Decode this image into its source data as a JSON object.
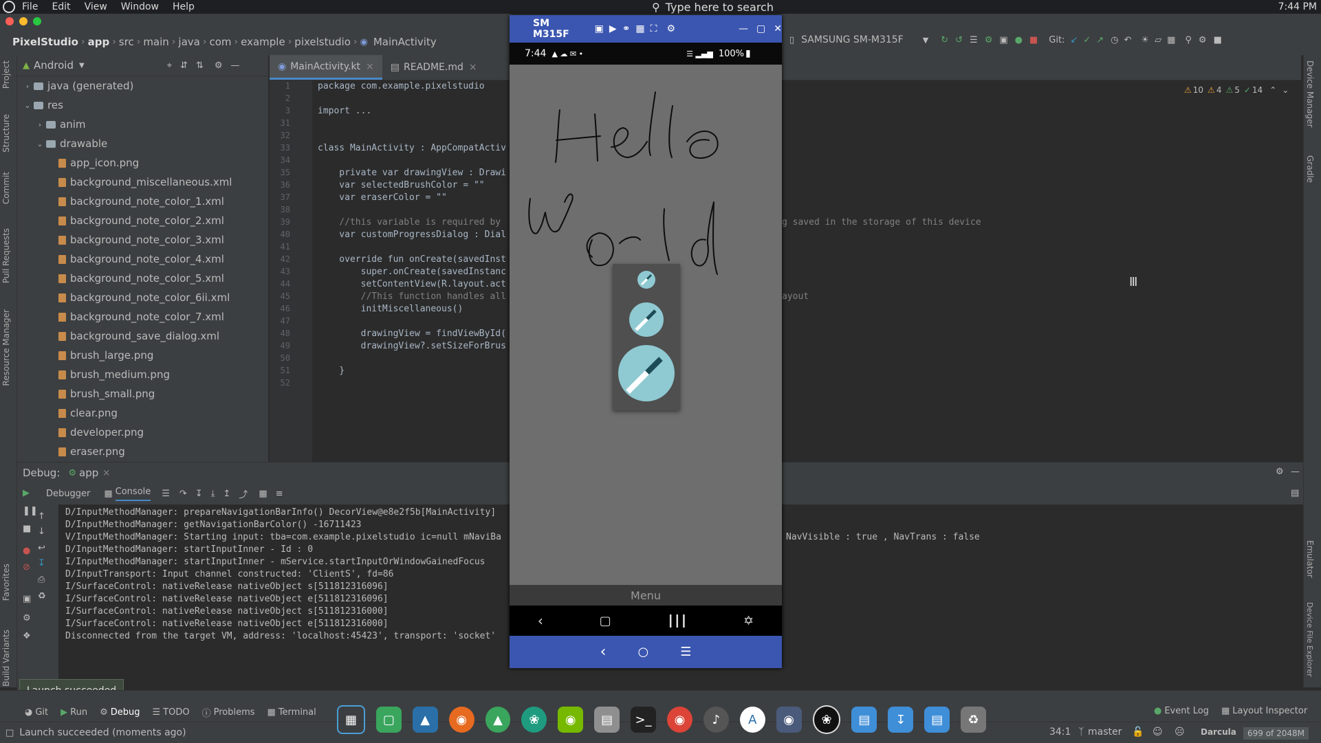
{
  "system_menu": {
    "items": [
      "File",
      "Edit",
      "View",
      "Window",
      "Help"
    ],
    "search_placeholder": "Type here to search",
    "clock": "7:44 PM"
  },
  "breadcrumb": [
    "PixelStudio",
    "app",
    "src",
    "main",
    "java",
    "com",
    "example",
    "pixelstudio",
    "MainActivity"
  ],
  "device_selector": "SAMSUNG SM-M315F",
  "git_label": "Git:",
  "project_panel": {
    "view_label": "Android",
    "tree": [
      {
        "label": "java (generated)",
        "depth": 1,
        "kind": "folder",
        "expanded": false
      },
      {
        "label": "res",
        "depth": 1,
        "kind": "folder",
        "expanded": true
      },
      {
        "label": "anim",
        "depth": 2,
        "kind": "folder",
        "expanded": false
      },
      {
        "label": "drawable",
        "depth": 2,
        "kind": "folder",
        "expanded": true
      },
      {
        "label": "app_icon.png",
        "depth": 3,
        "kind": "file"
      },
      {
        "label": "background_miscellaneous.xml",
        "depth": 3,
        "kind": "file"
      },
      {
        "label": "background_note_color_1.xml",
        "depth": 3,
        "kind": "file"
      },
      {
        "label": "background_note_color_2.xml",
        "depth": 3,
        "kind": "file"
      },
      {
        "label": "background_note_color_3.xml",
        "depth": 3,
        "kind": "file"
      },
      {
        "label": "background_note_color_4.xml",
        "depth": 3,
        "kind": "file"
      },
      {
        "label": "background_note_color_5.xml",
        "depth": 3,
        "kind": "file"
      },
      {
        "label": "background_note_color_6ii.xml",
        "depth": 3,
        "kind": "file"
      },
      {
        "label": "background_note_color_7.xml",
        "depth": 3,
        "kind": "file"
      },
      {
        "label": "background_save_dialog.xml",
        "depth": 3,
        "kind": "file"
      },
      {
        "label": "brush_large.png",
        "depth": 3,
        "kind": "file"
      },
      {
        "label": "brush_medium.png",
        "depth": 3,
        "kind": "file"
      },
      {
        "label": "brush_small.png",
        "depth": 3,
        "kind": "file"
      },
      {
        "label": "clear.png",
        "depth": 3,
        "kind": "file"
      },
      {
        "label": "developer.png",
        "depth": 3,
        "kind": "file"
      },
      {
        "label": "eraser.png",
        "depth": 3,
        "kind": "file"
      }
    ]
  },
  "editor": {
    "tabs": [
      {
        "label": "MainActivity.kt",
        "active": true
      },
      {
        "label": "README.md",
        "active": false
      }
    ],
    "inspection": {
      "warnings": "10",
      "weak": "4",
      "typos": "5",
      "ok": "14"
    },
    "line_numbers": [
      "1",
      "2",
      "3",
      "31",
      "32",
      "33",
      "34",
      "35",
      "36",
      "37",
      "38",
      "39",
      "40",
      "41",
      "42",
      "43",
      "44",
      "45",
      "46",
      "47",
      "48",
      "49",
      "50",
      "51",
      "52"
    ],
    "lines": [
      "package com.example.pixelstudio",
      "",
      "import ...",
      "",
      "",
      "class MainActivity : AppCompatActiv",
      "",
      "    private var drawingView : Drawi",
      "    var selectedBrushColor = \"\"",
      "    var eraserColor = \"\"",
      "",
      "    //this variable is required by",
      "    var customProgressDialog : Dial",
      "",
      "    override fun onCreate(savedInst",
      "        super.onCreate(savedInstanc",
      "        setContentView(R.layout.act",
      "        //This function handles all",
      "        initMiscellaneous()",
      "",
      "        drawingView = findViewById(",
      "        drawingView?.setSizeForBrus",
      "",
      "    }",
      ""
    ],
    "overflow_line_39": "g saved in the storage of this device",
    "overflow_line_45": "ayout"
  },
  "debug": {
    "title": "Debug:",
    "config": "app",
    "tabs": [
      "Debugger",
      "Console"
    ],
    "console": [
      "D/InputMethodManager: prepareNavigationBarInfo() DecorView@e8e2f5b[MainActivity]",
      "D/InputMethodManager: getNavigationBarColor() -16711423",
      "V/InputMethodManager: Starting input: tba=com.example.pixelstudio ic=null mNaviBa",
      "D/InputMethodManager: startInputInner - Id : 0",
      "I/InputMethodManager: startInputInner - mService.startInputOrWindowGainedFocus",
      "D/InputTransport: Input channel constructed: 'ClientS', fd=86",
      "I/SurfaceControl: nativeRelease nativeObject s[511812316096]",
      "I/SurfaceControl: nativeRelease nativeObject e[511812316096]",
      "I/SurfaceControl: nativeRelease nativeObject s[511812316000]",
      "I/SurfaceControl: nativeRelease nativeObject e[511812316000]",
      "Disconnected from the target VM, address: 'localhost:45423', transport: 'socket'"
    ],
    "console_overflow_line_3": "NavVisible : true , NavTrans : false"
  },
  "toast": "Launch succeeded",
  "bottom_tabs": [
    "Git",
    "Run",
    "Debug",
    "TODO",
    "Problems",
    "Terminal"
  ],
  "bottom_right_tabs": [
    "Event Log",
    "Layout Inspector"
  ],
  "status": {
    "message": "Launch succeeded (moments ago)",
    "position": "34:1",
    "branch": "master",
    "theme": "Darcula",
    "memory": "699 of 2048M"
  },
  "left_tool_tabs": [
    "Project",
    "Structure",
    "Commit",
    "Pull Requests",
    "Resource Manager",
    "Favorites",
    "Build Variants"
  ],
  "right_tool_tabs": [
    "Device Manager",
    "Gradle",
    "Emulator",
    "Device File Explorer"
  ],
  "phone": {
    "window_title": "SM M315F",
    "status_time": "7:44",
    "battery": "100%",
    "menu_label": "Menu",
    "handwriting": "Hello World"
  }
}
